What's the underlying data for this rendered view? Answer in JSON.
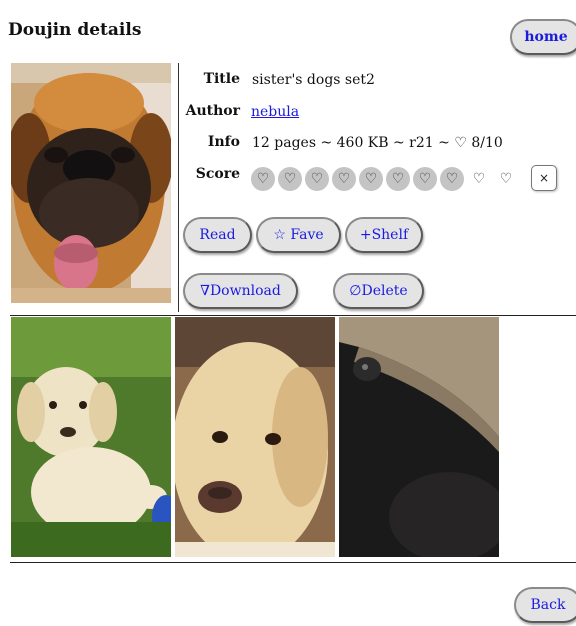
{
  "page": {
    "title": "Doujin details"
  },
  "nav": {
    "home_label": "home",
    "back_label": "Back"
  },
  "details": {
    "title_label": "Title",
    "title_value": "sister's dogs set2",
    "author_label": "Author",
    "author_value": "nebula",
    "info_label": "Info",
    "info_value": "12 pages  ~  460 KB  ~  r21  ~  ♡ 8/10",
    "score_label": "Score",
    "score": {
      "value": 8,
      "max": 10,
      "heart_glyph": "♡",
      "clear_glyph": "×"
    }
  },
  "actions": {
    "read_label": "Read",
    "fave_label": "☆ Fave",
    "shelf_label": "+Shelf",
    "download_label": "∇Download",
    "delete_label": "∅Delete"
  },
  "colors": {
    "link": "#1a1ae0",
    "button_bg": "#e4e4e4",
    "heart_fill": "#c4c4c4"
  },
  "images": {
    "cover": "mastiff dog face",
    "thumbnails": [
      "labrador puppy on grass",
      "yellow labrador face",
      "black pug under knit hat"
    ]
  }
}
